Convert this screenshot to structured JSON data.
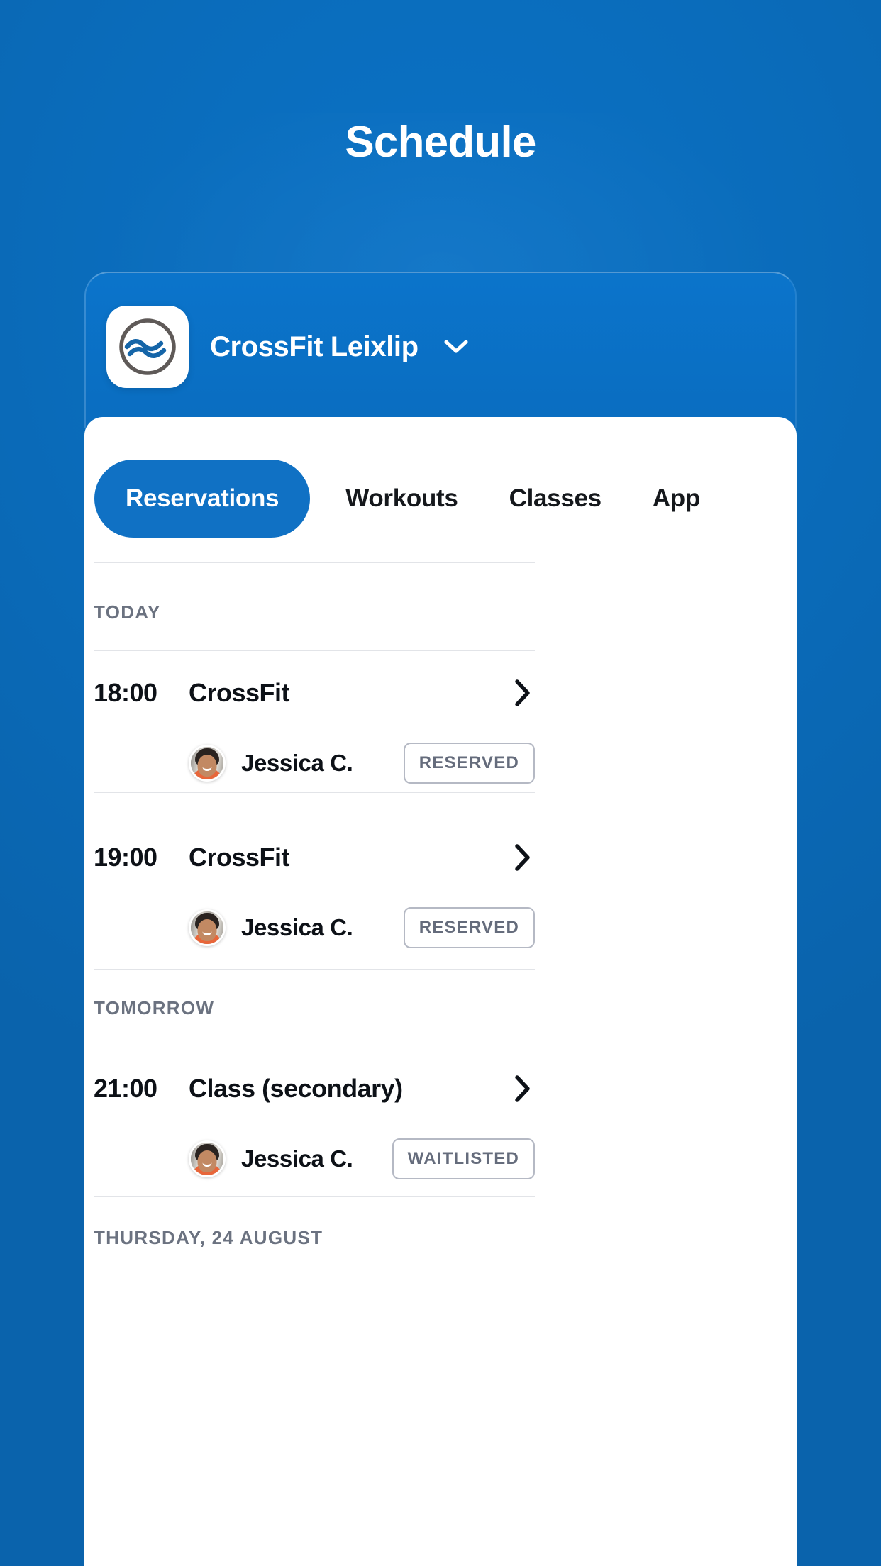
{
  "page": {
    "title": "Schedule",
    "background_color": "#0a6ebd",
    "accent_color": "#1071c4"
  },
  "gym_selector": {
    "name": "CrossFit Leixlip",
    "logo_icon": "wave-circle-logo",
    "chevron_icon": "chevron-down-icon"
  },
  "tabs": [
    {
      "label": "Reservations",
      "active": true
    },
    {
      "label": "Workouts",
      "active": false
    },
    {
      "label": "Classes",
      "active": false
    },
    {
      "label": "App",
      "active": false
    }
  ],
  "sections": [
    {
      "heading": "TODAY",
      "classes": [
        {
          "time": "18:00",
          "name": "CrossFit",
          "chevron_icon": "chevron-right-icon",
          "attendees": [
            {
              "name": "Jessica C.",
              "status": "RESERVED",
              "avatar_icon": "user-avatar"
            }
          ]
        },
        {
          "time": "19:00",
          "name": "CrossFit",
          "chevron_icon": "chevron-right-icon",
          "attendees": [
            {
              "name": "Jessica C.",
              "status": "RESERVED",
              "avatar_icon": "user-avatar"
            }
          ]
        }
      ]
    },
    {
      "heading": "TOMORROW",
      "classes": [
        {
          "time": "21:00",
          "name": "Class (secondary)",
          "chevron_icon": "chevron-right-icon",
          "attendees": [
            {
              "name": "Jessica C.",
              "status": "WAITLISTED",
              "avatar_icon": "user-avatar"
            }
          ]
        }
      ]
    },
    {
      "heading": "THURSDAY, 24 AUGUST",
      "classes": []
    }
  ]
}
